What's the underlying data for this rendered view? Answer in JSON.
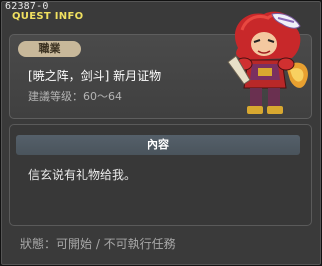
{
  "window": {
    "quest_id": "62387-0",
    "title": "QUEST INFO"
  },
  "summary": {
    "job_label": "職業",
    "quest_name": "[暁之阵，剑斗] 新月证物",
    "level_recommendation": "建議等级：60～64"
  },
  "portrait": {
    "icon": "red-armored-warrior-portrait"
  },
  "detail": {
    "header": "內容",
    "text": "信玄说有礼物给我。"
  },
  "footer": {
    "status": "狀態：可開始 / 不可執行任務"
  }
}
